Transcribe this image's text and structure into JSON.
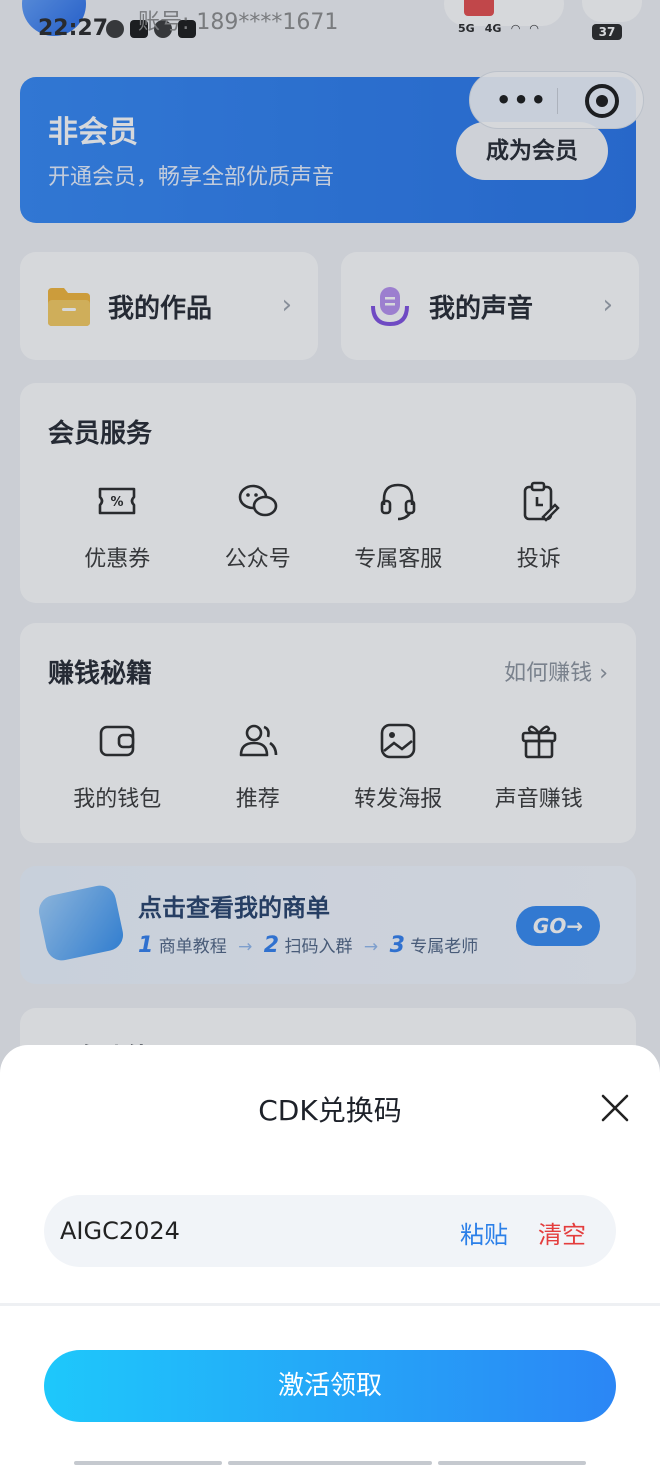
{
  "status_bar": {
    "time": "22:27",
    "account": "账号: 189****1671",
    "signal_1": "5G",
    "signal_2": "4G",
    "battery": "37"
  },
  "member": {
    "title": "非会员",
    "subtitle": "开通会员，畅享全部优质声音",
    "cta": "成为会员"
  },
  "capsule": {
    "more": "•••"
  },
  "quick_links": [
    {
      "label": "我的作品",
      "icon": "folder-icon"
    },
    {
      "label": "我的声音",
      "icon": "microphone-icon"
    }
  ],
  "member_services": {
    "title": "会员服务",
    "items": [
      {
        "label": "优惠券",
        "icon": "coupon-icon"
      },
      {
        "label": "公众号",
        "icon": "wechat-icon"
      },
      {
        "label": "专属客服",
        "icon": "headset-icon"
      },
      {
        "label": "投诉",
        "icon": "complaint-icon"
      }
    ]
  },
  "earn": {
    "title": "赚钱秘籍",
    "link": "如何赚钱",
    "items": [
      {
        "label": "我的钱包",
        "icon": "wallet-icon"
      },
      {
        "label": "推荐",
        "icon": "users-icon"
      },
      {
        "label": "转发海报",
        "icon": "poster-icon"
      },
      {
        "label": "声音赚钱",
        "icon": "gift-icon"
      }
    ]
  },
  "banner": {
    "title": "点击查看我的商单",
    "step1_num": "1",
    "step1": "商单教程",
    "step2_num": "2",
    "step2": "扫码入群",
    "step3_num": "3",
    "step3": "专属老师",
    "go": "GO→"
  },
  "more_section": {
    "title": "更多功能"
  },
  "sheet": {
    "title": "CDK兑换码",
    "code_value": "AIGC2024",
    "paste": "粘贴",
    "clear": "清空",
    "activate": "激活领取"
  },
  "colors": {
    "accent": "#2b7fe8",
    "danger": "#e43d3d",
    "member_card": "#2c83f5"
  }
}
